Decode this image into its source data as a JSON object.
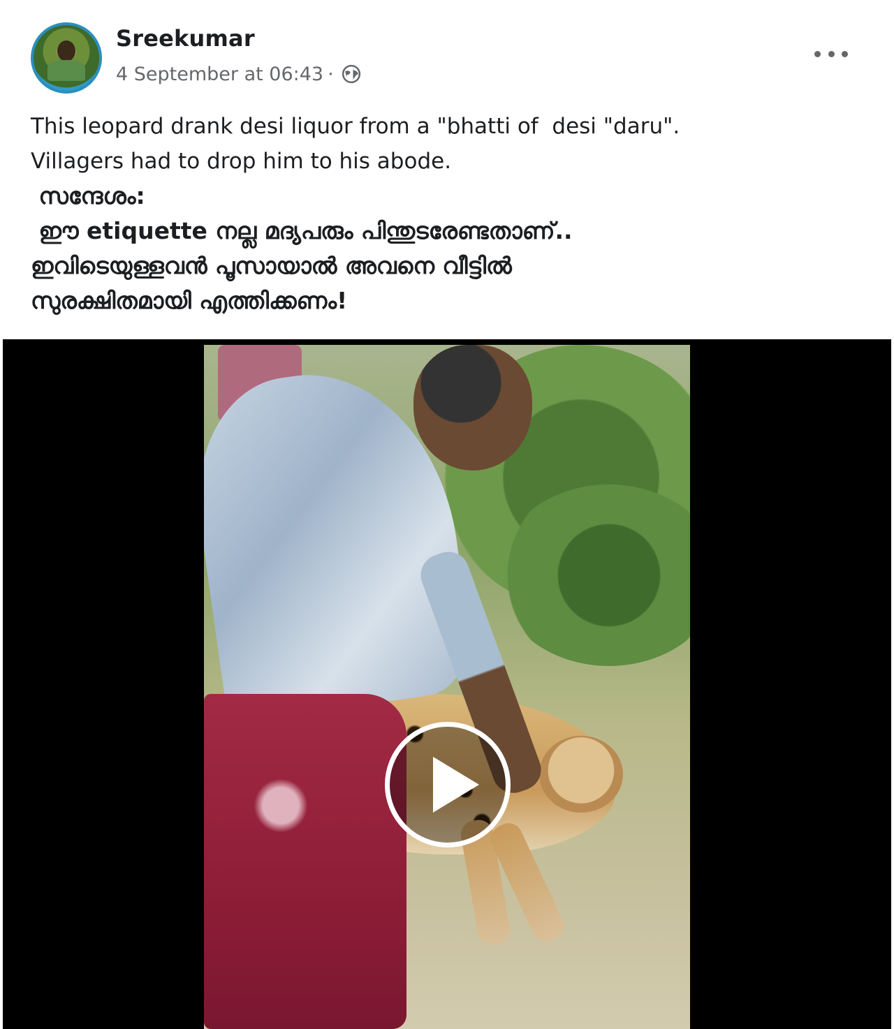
{
  "post": {
    "author": "Sreekumar",
    "timestamp": "4 September at 06:43",
    "separator": "·",
    "privacy_icon": "globe-icon",
    "more_icon": "more-options-icon",
    "text_lines": [
      "This leopard drank desi liquor from a \"bhatti of  desi \"daru\".",
      "Villagers had to drop him to his abode.",
      " സന്ദേശം:",
      " ഈ etiquette നല്ല മദ്യപരും പിന്തുടരേണ്ടതാണ്..",
      "ഇവിടെയുള്ളവൻ പൂസായാൽ അവനെ വീട്ടിൽ",
      "സുരക്ഷിതമായി എത്തിക്കണം!"
    ]
  },
  "media": {
    "type": "video",
    "play_icon": "play-icon"
  },
  "colors": {
    "author_text": "#1c1e21",
    "meta_text": "#65676b",
    "video_background": "#000000",
    "avatar_ring": "#2a8fbd"
  }
}
